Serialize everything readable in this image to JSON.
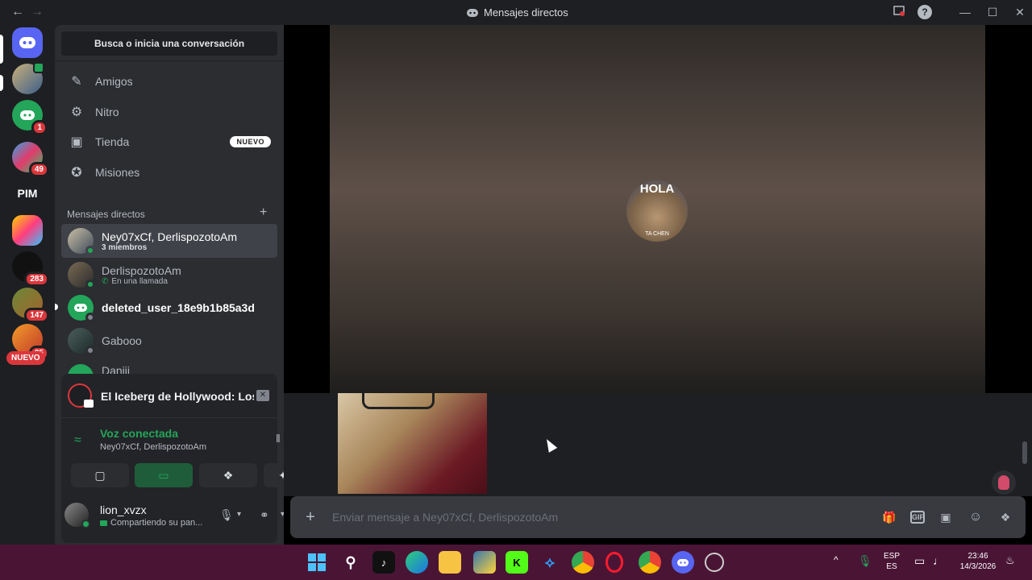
{
  "window": {
    "title": "Mensajes directos",
    "back": "←",
    "forward": "→",
    "minimize": "—",
    "maximize": "☐",
    "close": "✕",
    "help": "?"
  },
  "rail": {
    "servers": [
      {
        "label": "",
        "badge": ""
      },
      {
        "label": "",
        "badge": ""
      },
      {
        "label": "",
        "badge": "1"
      },
      {
        "label": "",
        "badge": "49"
      },
      {
        "label": "PIM",
        "badge": ""
      },
      {
        "label": "",
        "badge": ""
      },
      {
        "label": "",
        "badge": "283"
      },
      {
        "label": "",
        "badge": "147"
      },
      {
        "label": "",
        "badge": "35"
      }
    ],
    "new_label": "NUEVO"
  },
  "sidebar": {
    "search_label": "Busca o inicia una conversación",
    "nav": [
      {
        "label": "Amigos",
        "icon": "friends-icon"
      },
      {
        "label": "Nitro",
        "icon": "nitro-icon"
      },
      {
        "label": "Tienda",
        "icon": "shop-icon",
        "tag": "NUEVO"
      },
      {
        "label": "Misiones",
        "icon": "quests-icon"
      }
    ],
    "dm_header": "Mensajes directos",
    "dm_add": "+",
    "dms": [
      {
        "name": "Ney07xCf, DerlispozotoAm",
        "sub": "3 miembros"
      },
      {
        "name": "DerlispozotoAm",
        "sub": "En una llamada"
      },
      {
        "name": "deleted_user_18e9b1b85a3d",
        "sub": ""
      },
      {
        "name": "Gabooo",
        "sub": ""
      },
      {
        "name": "Daniii",
        "sub": ""
      }
    ]
  },
  "stream": {
    "title": "El Iceberg de Hollywood: Los Miste...",
    "voice_status": "Voz conectada",
    "voice_channel": "Ney07xCf, DerlispozotoAm"
  },
  "user": {
    "name": "lion_xvzx",
    "status": "Compartiendo su pan..."
  },
  "call": {
    "avatar_text": "HOLA",
    "avatar_caption": "TA CHEN"
  },
  "composer": {
    "placeholder": "Enviar mensaje a Ney07xCf, DerlispozotoAm",
    "gif": "GIF"
  },
  "taskbar": {
    "lang1": "ESP",
    "lang2": "ES",
    "time": "23:46",
    "date": "14/3/2026",
    "apps": [
      "K"
    ]
  },
  "colors": {
    "accent": "#5865f2",
    "green": "#23a55a",
    "red": "#da373c",
    "taskbar": "#4a1535"
  }
}
